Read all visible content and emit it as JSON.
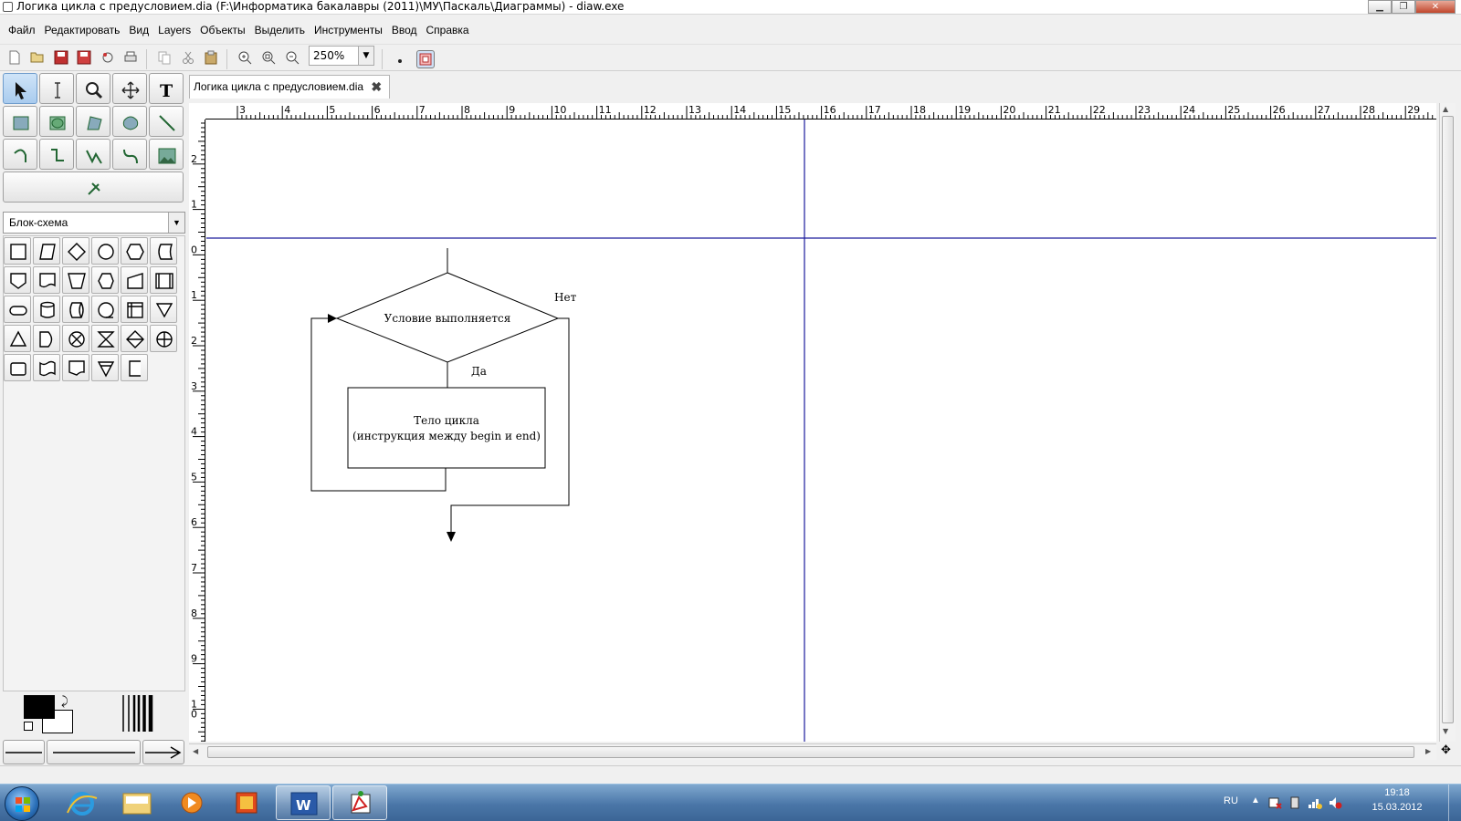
{
  "window": {
    "title": "Логика цикла с предусловием.dia (F:\\Информатика бакалавры (2011)\\МУ\\Паскаль\\Диаграммы) - diaw.exe",
    "controls": [
      "▁",
      "❐",
      "✕"
    ]
  },
  "menu": [
    "Файл",
    "Редактировать",
    "Вид",
    "Layers",
    "Объекты",
    "Выделить",
    "Инструменты",
    "Ввод",
    "Справка"
  ],
  "toolbar": {
    "zoom_value": "250%"
  },
  "toolbox": {
    "sheet_selected": "Блок-схема"
  },
  "tab": {
    "label": "Логика цикла с предусловием.dia",
    "close": "✖"
  },
  "rulers": {
    "horizontal_ticks": [
      "3",
      "4",
      "5",
      "6",
      "7",
      "8",
      "9",
      "10",
      "11",
      "12",
      "13",
      "14",
      "15",
      "16",
      "17",
      "18",
      "19",
      "20",
      "21",
      "22",
      "23",
      "24",
      "25",
      "26",
      "27",
      "28",
      "29"
    ],
    "vertical_ticks": [
      "-",
      "2",
      "1",
      "0",
      "1",
      "2",
      "3",
      "4",
      "5",
      "6",
      "7",
      "8",
      "9",
      "1\n0"
    ]
  },
  "diagram": {
    "decision_text": "Условие выполняется",
    "no_label": "Нет",
    "yes_label": "Да",
    "process_line1": "Тело цикла",
    "process_line2": "(инструкция между begin и end)"
  },
  "tray": {
    "lang": "RU",
    "time": "19:18",
    "date": "15.03.2012"
  },
  "colors": {
    "guide": "#1c1c9c",
    "canvas": "#ffffff",
    "taskbar": "#4a76a8"
  }
}
